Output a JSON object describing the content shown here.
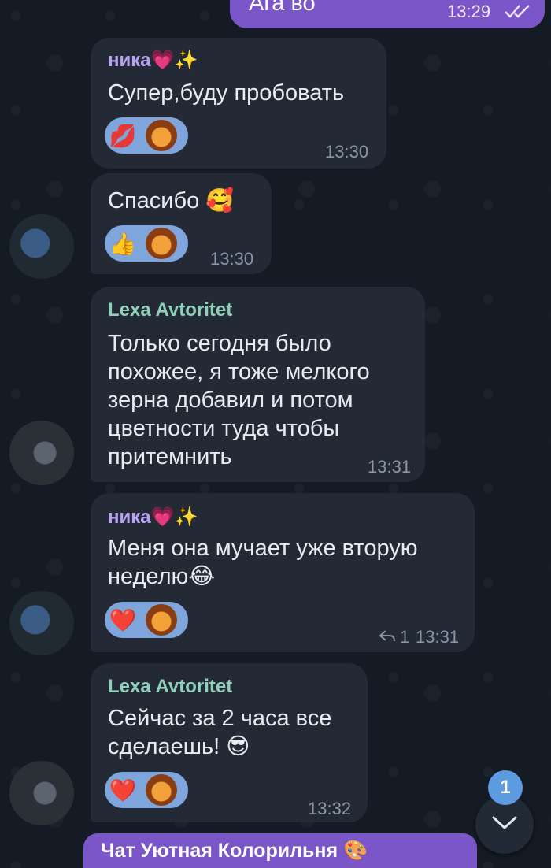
{
  "outgoing": {
    "text": "Ага во",
    "time": "13:29",
    "status_icon": "double-check-icon"
  },
  "messages": [
    {
      "sender": "ника💗✨",
      "text": "Супер,буду пробовать",
      "time": "13:30",
      "reaction_emoji": "💋"
    },
    {
      "text": "Спасибо 🥰",
      "time": "13:30",
      "reaction_emoji": "👍"
    },
    {
      "sender": "Lexa Avtoritet",
      "text": "Только сегодня было\nпохожее, я тоже мелкого\nзерна добавил и потом\nцветности туда чтобы\nпритемнить",
      "time": "13:31"
    },
    {
      "sender": "ника💗✨",
      "text": "Меня она мучает уже вторую\nнеделю😂",
      "time": "13:31",
      "reply_count": "1",
      "reaction_emoji": "❤️"
    },
    {
      "sender": "Lexa Avtoritet",
      "text": "Сейчас за 2 часа все\nсделаешь! 😎",
      "time": "13:32",
      "reaction_emoji": "❤️"
    }
  ],
  "unread_badge": "1",
  "chat_bar_title": "Чат Уютная Колорильня 🎨"
}
